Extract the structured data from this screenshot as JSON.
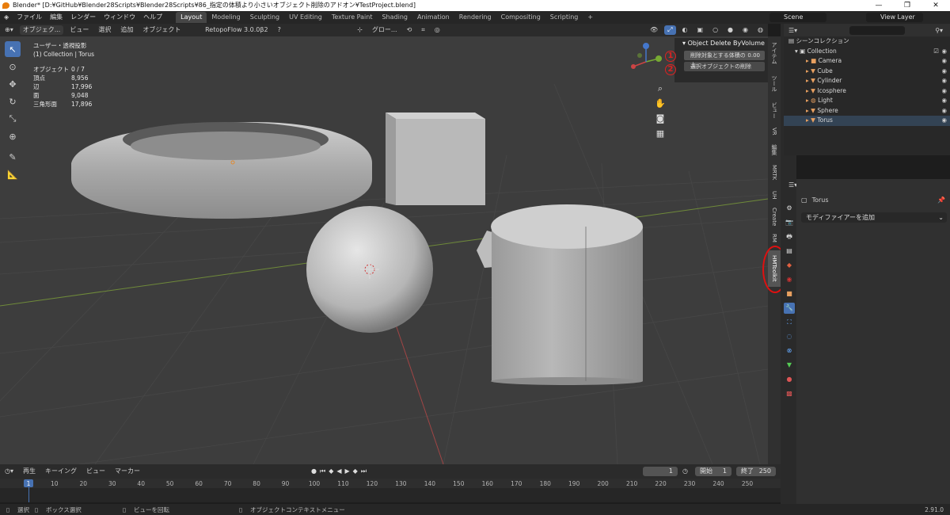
{
  "window": {
    "title": "Blender* [D:¥GitHub¥Blender28Scripts¥Blender28Scripts¥86_指定の体積より小さいオブジェクト削除のアドオン¥TestProject.blend]",
    "controls": [
      "—",
      "❐",
      "✕"
    ]
  },
  "menu": [
    "ファイル",
    "編集",
    "レンダー",
    "ウィンドウ",
    "ヘルプ"
  ],
  "workspaces": [
    "Layout",
    "Modeling",
    "Sculpting",
    "UV Editing",
    "Texture Paint",
    "Shading",
    "Animation",
    "Rendering",
    "Compositing",
    "Scripting",
    "+"
  ],
  "active_workspace": "Layout",
  "scene": "Scene",
  "view_layer": "View Layer",
  "viewport_header": {
    "mode": "オブジェク...",
    "items": [
      "ビュー",
      "選択",
      "追加",
      "オブジェクト"
    ],
    "addon": "RetopoFlow 3.0.0β2",
    "orientation": "グロー..."
  },
  "viewport": {
    "view_name": "ユーザー・透視投影",
    "collection": "(1) Collection | Torus"
  },
  "stats": [
    {
      "k": "オブジェクト",
      "v": "0 / 7"
    },
    {
      "k": "頂点",
      "v": "8,956"
    },
    {
      "k": "辺",
      "v": "17,996"
    },
    {
      "k": "面",
      "v": "9,048"
    },
    {
      "k": "三角形面",
      "v": "17,896"
    }
  ],
  "addon_panel": {
    "title": "Object Delete ByVolume",
    "threshold_label": "削除対象とする体積の上",
    "threshold_value": "0.00",
    "delete_button": "選択オブジェクトの削除",
    "badges": [
      "1",
      "2"
    ]
  },
  "sidebar_tabs": [
    "アイテム",
    "ツール",
    "ビュー",
    "VR",
    "編集",
    "MRTK",
    "UH",
    "Create",
    "RM",
    "HMToolkit"
  ],
  "highlighted_tab": "HMToolkit",
  "outliner": {
    "title": "シーンコレクション",
    "collection": "Collection",
    "items": [
      {
        "name": "Camera",
        "color": "#e8a060"
      },
      {
        "name": "Cube",
        "color": "#e8a060"
      },
      {
        "name": "Cylinder",
        "color": "#e8a060"
      },
      {
        "name": "Icosphere",
        "color": "#e8a060"
      },
      {
        "name": "Light",
        "color": "#e8a060"
      },
      {
        "name": "Sphere",
        "color": "#e8a060"
      },
      {
        "name": "Torus",
        "color": "#e8a060"
      }
    ]
  },
  "properties": {
    "object_name": "Torus",
    "add_modifier": "モディファイアーを追加"
  },
  "timeline_header": {
    "items": [
      "再生",
      "キーイング",
      "ビュー",
      "マーカー"
    ],
    "current_frame": "1",
    "start_label": "開始",
    "start": "1",
    "end_label": "終了",
    "end": "250"
  },
  "timeline_ticks": [
    "1",
    "10",
    "20",
    "30",
    "40",
    "50",
    "60",
    "70",
    "80",
    "90",
    "100",
    "110",
    "120",
    "130",
    "140",
    "150",
    "160",
    "170",
    "180",
    "190",
    "200",
    "210",
    "220",
    "230",
    "240",
    "250"
  ],
  "statusbar": {
    "select": "選択",
    "box_select": "ボックス選択",
    "rotate": "ビューを回転",
    "context": "オブジェクトコンテキストメニュー",
    "version": "2.91.0"
  },
  "colors": {
    "accent": "#4772b3",
    "highlight_red": "#e01010",
    "object_orange": "#e8a060"
  }
}
